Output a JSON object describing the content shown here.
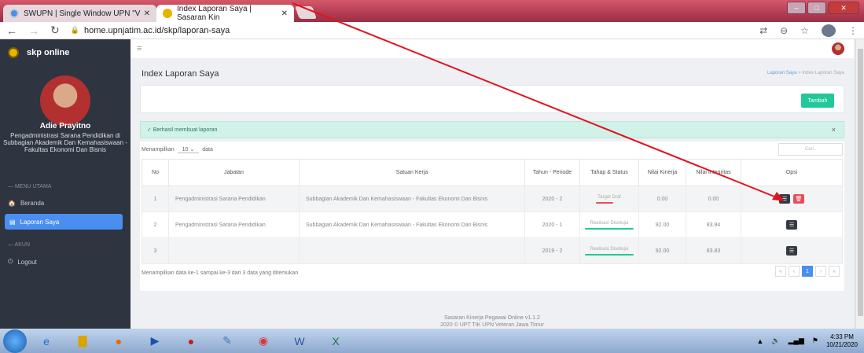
{
  "browser": {
    "tabs": [
      {
        "label": "SWUPN | Single Window UPN \"V"
      },
      {
        "label": "Index Laporan Saya | Sasaran Kin"
      }
    ],
    "url": "home.upnjatim.ac.id/skp/laporan-saya"
  },
  "sidebar": {
    "brand": "skp online",
    "user_name": "Adie Prayitno",
    "user_role": "Pengadministrasi Sarana Pendidikan di Subbagian Akademik Dan Kemahasiswaan - Fakultas Ekonomi Dan Bisnis",
    "section_main": "— MENU UTAMA",
    "item_beranda": "Beranda",
    "item_laporan": "Laporan Saya",
    "section_akun": "— AKUN",
    "item_logout": "Logout"
  },
  "main": {
    "title": "Index Laporan Saya",
    "breadcrumb_1": "Laporan Saya",
    "breadcrumb_sep": ">",
    "breadcrumb_2": "Index Laporan Saya",
    "add_button": "Tambah",
    "alert_text": "✓ Berhasil membuat laporan",
    "alert_close": "×",
    "show_label": "Menampilkan",
    "show_value": "10",
    "show_suffix": "data",
    "search_placeholder": "Cari..",
    "columns": [
      "No",
      "Jabatan",
      "Satuan Kerja",
      "Tahun - Periode",
      "Tahap & Status",
      "Nilai Kinerja",
      "Nilai Integritas",
      "Opsi"
    ],
    "rows": [
      {
        "no": "1",
        "jabatan": "Pengadministrasi Sarana Pendidikan",
        "satuan": "Subbagian Akademik Dan Kemahasiswaan - Fakultas Ekonomi Dan Bisnis",
        "periode": "2020 - 2",
        "status": "Target Draf",
        "status_color": "#e74c5c",
        "kinerja": "0.00",
        "integritas": "0.00",
        "actions": [
          "edit",
          "delete"
        ]
      },
      {
        "no": "2",
        "jabatan": "Pengadministrasi Sarana Pendidikan",
        "satuan": "Subbagian Akademik Dan Kemahasiswaan - Fakultas Ekonomi Dan Bisnis",
        "periode": "2020 - 1",
        "status": "Realisasi Disetujui",
        "status_color": "#20c997",
        "kinerja": "92.00",
        "integritas": "83.84",
        "actions": [
          "edit"
        ]
      },
      {
        "no": "3",
        "jabatan": "",
        "satuan": "",
        "periode": "2019 - 2",
        "status": "Realisasi Disetujui",
        "status_color": "#20c997",
        "kinerja": "92.00",
        "integritas": "83.83",
        "actions": [
          "edit"
        ]
      }
    ],
    "info_text": "Menampilkan data ke-1 sampai ke-3 dari 3 data yang ditemukan",
    "pagination": [
      "«",
      "‹",
      "1",
      "›",
      "»"
    ],
    "current_page": "1",
    "footer_1": "Sasaran Kinerja Pegawai Online v1.1.2",
    "footer_2": "2020 © UPT TIK UPN Veteran Jawa Timur"
  },
  "taskbar": {
    "time": "4:33 PM",
    "date": "10/21/2020"
  }
}
